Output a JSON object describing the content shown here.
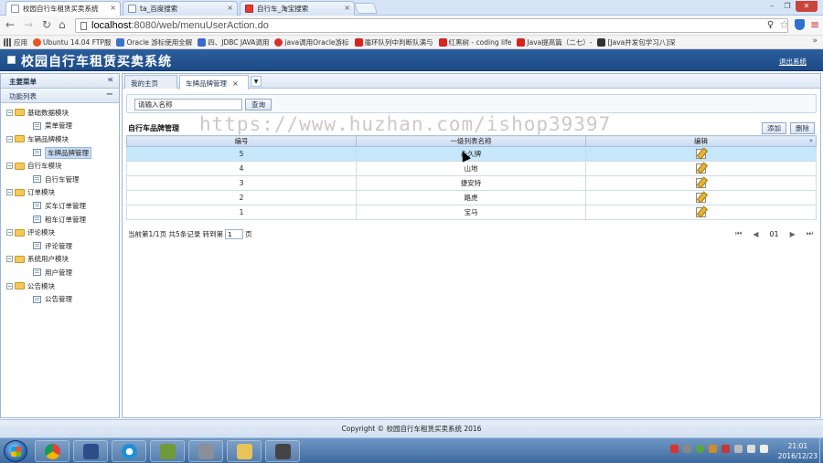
{
  "browser": {
    "tabs": [
      {
        "title": "校园自行车租赁买卖系统",
        "close": "×"
      },
      {
        "title": "ta_百度搜索",
        "close": "×"
      },
      {
        "title": "自行车_淘宝搜索",
        "close": "×"
      }
    ],
    "window_controls": {
      "minimize": "–",
      "restore": "❐",
      "close": "✕"
    },
    "url_host": "localhost",
    "url_path": ":8080/web/menuUserAction.do",
    "bookmarks": [
      {
        "label": "应用",
        "icon": "apps-icon"
      },
      {
        "label": "Ubuntu 14.04 FTP服",
        "icon": "ubuntu-icon"
      },
      {
        "label": "Oracle 游标使用全解",
        "icon": "oracle-icon"
      },
      {
        "label": "四、JDBC JAVA调用",
        "icon": "g-icon"
      },
      {
        "label": "java调用Oracle游标",
        "icon": "baidu-icon"
      },
      {
        "label": "循环队列中判断队满与",
        "icon": "c-icon"
      },
      {
        "label": "红黑树 - coding life",
        "icon": "c-icon"
      },
      {
        "label": "Java提高篇（二七）-",
        "icon": "c-icon"
      },
      {
        "label": "[Java并发包学习八]深",
        "icon": "book-icon"
      }
    ],
    "bookmarks_more": "»"
  },
  "app": {
    "title": "校园自行车租赁买卖系统",
    "logout": "退出系统"
  },
  "sidebar": {
    "header": "主要菜单",
    "header_ctl": "«",
    "sub_header": "功能列表",
    "sub_header_ctl": "−",
    "tree": [
      {
        "label": "基础数据模块",
        "children": [
          "菜单管理"
        ]
      },
      {
        "label": "车辆品牌模块",
        "children": [
          "车牌品牌管理"
        ]
      },
      {
        "label": "自行车模块",
        "children": [
          "自行车管理"
        ]
      },
      {
        "label": "订单模块",
        "children": [
          "买车订单管理",
          "租车订单管理"
        ]
      },
      {
        "label": "评论模块",
        "children": [
          "评论管理"
        ]
      },
      {
        "label": "系统用户模块",
        "children": [
          "用户管理"
        ]
      },
      {
        "label": "公告模块",
        "children": [
          "公告管理"
        ]
      }
    ],
    "selected": "车牌品牌管理"
  },
  "content": {
    "tabs": [
      {
        "label": "我的主页",
        "close": ""
      },
      {
        "label": "车牌品牌管理",
        "close": "×"
      }
    ],
    "search": {
      "value": "请输入名称",
      "button": "查询"
    },
    "grid_title": "自行车品牌管理",
    "buttons": {
      "add": "添加",
      "delete": "删除"
    },
    "columns": [
      "编号",
      "一级列表名称",
      "编辑"
    ],
    "collapse_icon": "»",
    "rows": [
      {
        "id": "5",
        "name": "永久牌"
      },
      {
        "id": "4",
        "name": "山地"
      },
      {
        "id": "3",
        "name": "捷安特"
      },
      {
        "id": "2",
        "name": "路虎"
      },
      {
        "id": "1",
        "name": "宝马"
      }
    ],
    "pager": {
      "summary": "当前第1/1页 共5条记录 转到第",
      "goto_value": "1",
      "suffix": "页",
      "first": "⏮",
      "prev": "◀",
      "page": "01",
      "next": "▶",
      "last": "⏭"
    }
  },
  "footer": "Copyright © 校园自行车租赁买卖系统 2016",
  "watermark": "https://www.huzhan.com/ishop39397",
  "taskbar": {
    "time": "21:01",
    "date": "2016/12/23"
  }
}
